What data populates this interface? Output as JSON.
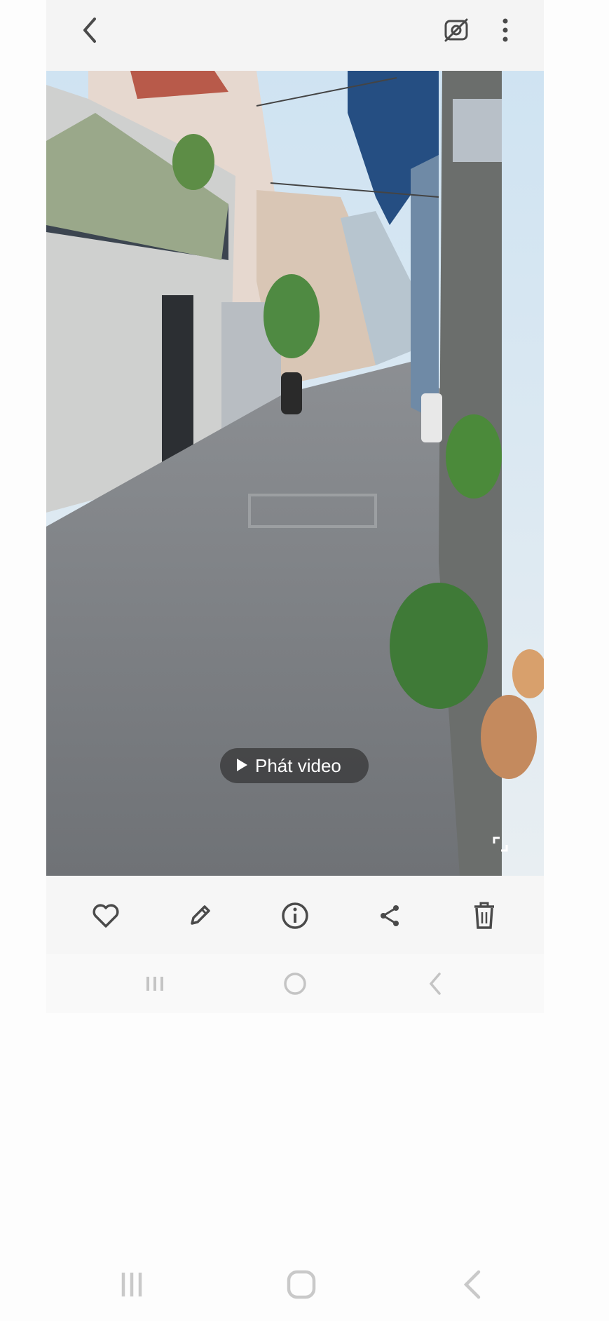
{
  "viewer": {
    "play_label": "Phát video",
    "icons": {
      "back": "back-arrow-icon",
      "motion_photo_off": "motion-photo-off-icon",
      "more": "more-options-icon",
      "expand": "expand-icon"
    }
  },
  "actions": [
    {
      "name": "favorite",
      "icon": "heart-icon"
    },
    {
      "name": "edit",
      "icon": "pencil-icon"
    },
    {
      "name": "details",
      "icon": "info-icon"
    },
    {
      "name": "share",
      "icon": "share-icon"
    },
    {
      "name": "delete",
      "icon": "trash-icon"
    }
  ],
  "system_nav": [
    "recents",
    "home",
    "back"
  ],
  "colors": {
    "icon": "#4a4a4a",
    "nav_icon_faint": "#c4c4c4",
    "pill_bg": "#2c2c2c"
  }
}
